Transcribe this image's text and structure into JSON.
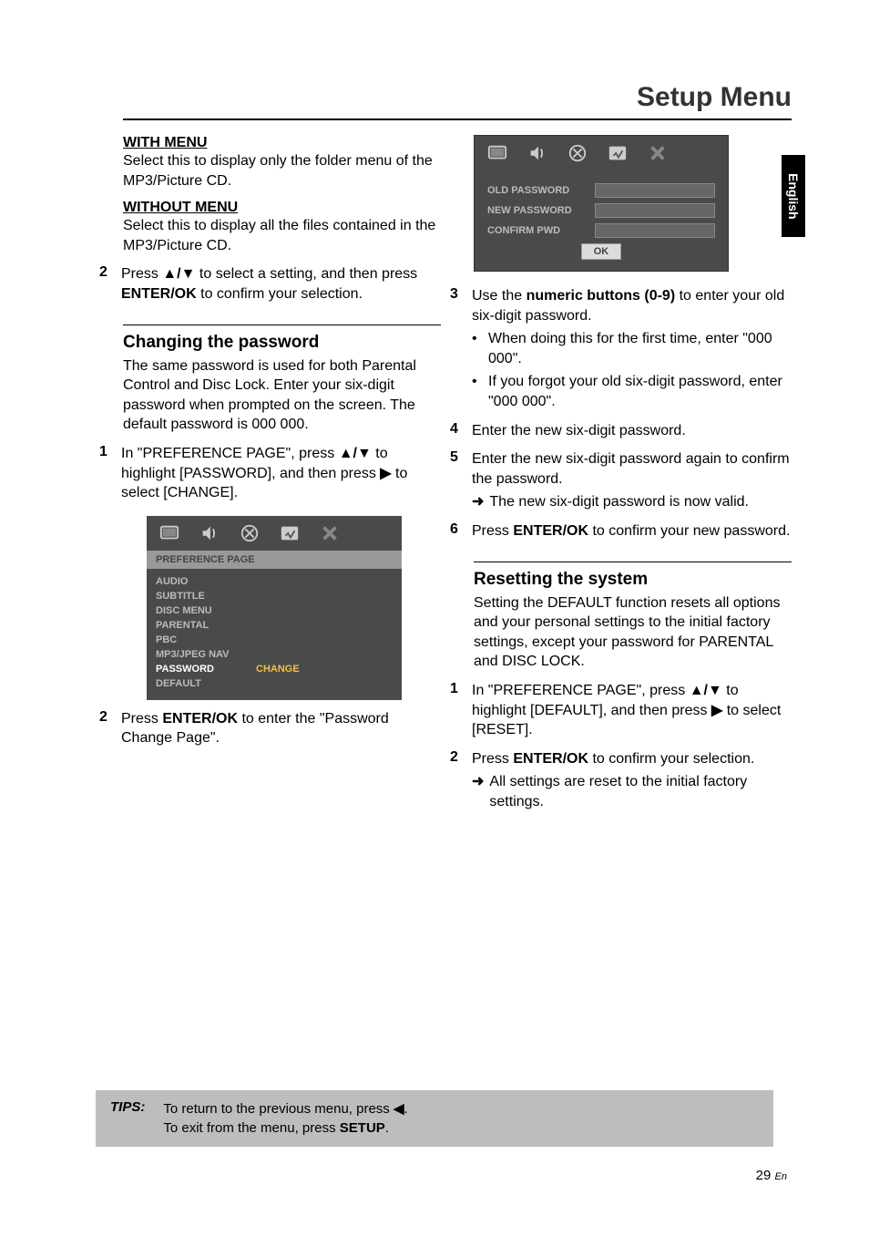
{
  "title": "Setup Menu",
  "sideTab": "English",
  "left": {
    "withMenu": {
      "head": "WITH MENU",
      "body": "Select this to display only the folder menu of the MP3/Picture CD."
    },
    "withoutMenu": {
      "head": "WITHOUT MENU",
      "body": "Select this to display all the files contained in the MP3/Picture CD."
    },
    "step2": {
      "n": "2",
      "a": "Press ",
      "b": "▲/▼",
      "c": " to select a setting, and then press ",
      "d": "ENTER/OK",
      "e": " to confirm your selection."
    },
    "chpw": {
      "head": "Changing the password",
      "body": "The same password is used for both Parental Control and Disc Lock. Enter your six-digit password when prompted on the screen. The default password is 000 000."
    },
    "step1b": {
      "n": "1",
      "a": "In \"PREFERENCE PAGE\", press ",
      "b": "▲/▼",
      "c": " to highlight [PASSWORD], and then press ",
      "d": "▶",
      "e": " to select [CHANGE]."
    },
    "step2b": {
      "n": "2",
      "a": "Press ",
      "b": "ENTER/OK",
      "c": " to enter the \"Password Change Page\"."
    }
  },
  "osd1": {
    "title": "PREFERENCE PAGE",
    "items": [
      "AUDIO",
      "SUBTITLE",
      "DISC MENU",
      "PARENTAL",
      "PBC",
      "MP3/JPEG NAV",
      "PASSWORD",
      "DEFAULT"
    ],
    "selVal": "CHANGE"
  },
  "osd2": {
    "rows": [
      "OLD PASSWORD",
      "NEW PASSWORD",
      "CONFIRM PWD"
    ],
    "ok": "OK"
  },
  "right": {
    "s3": {
      "n": "3",
      "a": "Use the ",
      "b": "numeric buttons (0-9)",
      "c": " to enter your old six-digit password."
    },
    "s3b1": "When doing this for the first time, enter \"000 000\".",
    "s3b2": "If you forgot your old six-digit password, enter \"000 000\".",
    "s4": {
      "n": "4",
      "t": "Enter the new six-digit password."
    },
    "s5": {
      "n": "5",
      "t": "Enter the new six-digit password again to confirm the password."
    },
    "s5a": "The new six-digit password is now valid.",
    "s6": {
      "n": "6",
      "a": "Press ",
      "b": "ENTER/OK",
      "c": " to confirm your new password."
    },
    "reset": {
      "head": "Resetting the system",
      "body": "Setting the DEFAULT function resets all options and your personal settings to the initial factory settings, except your password for PARENTAL and DISC LOCK."
    },
    "r1": {
      "n": "1",
      "a": "In \"PREFERENCE PAGE\", press ",
      "b": "▲/▼",
      "c": " to highlight [DEFAULT], and then press ",
      "d": "▶",
      "e": " to select [RESET]."
    },
    "r2": {
      "n": "2",
      "a": "Press ",
      "b": "ENTER/OK",
      "c": " to confirm your selection."
    },
    "r2a": "All settings are reset to the initial factory settings."
  },
  "tips": {
    "label": "TIPS:",
    "l1a": "To return to the previous menu, press ",
    "l1b": "◀",
    "l1c": ".",
    "l2a": "To exit from the menu, press ",
    "l2b": "SETUP",
    "l2c": "."
  },
  "pageNum": "29",
  "pageLang": "En",
  "arrow": "➜"
}
